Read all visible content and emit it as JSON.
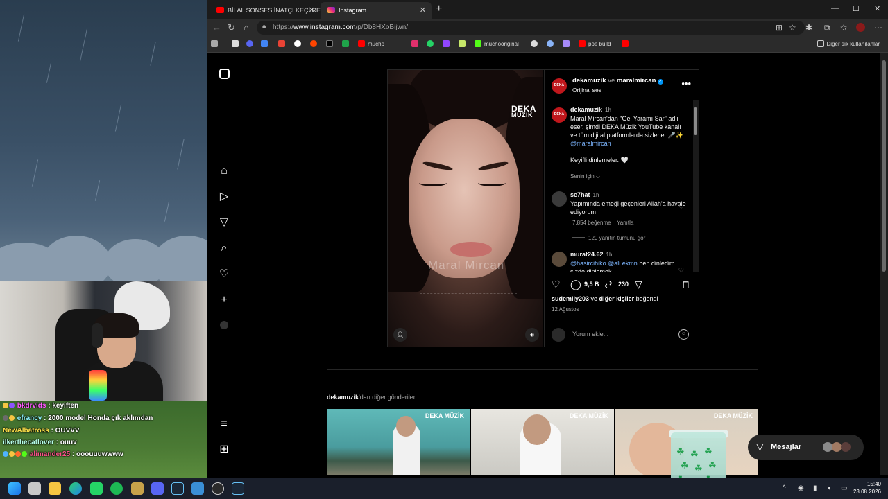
{
  "browser": {
    "tabs": [
      {
        "label": "BİLAL SONSES İNATÇI KEÇİ REMİX",
        "close": "✕"
      },
      {
        "label": "Instagram",
        "close": "✕"
      }
    ],
    "new_tab": "+",
    "url_prefix": "https://",
    "url_domain": "www.instagram.com",
    "url_path": "/p/Db8HXoBijwn/",
    "bookmarks": [
      {
        "label": "mucho",
        "color": "#ff0000"
      },
      {
        "label": "muchooriginal",
        "color": "#53fc18"
      },
      {
        "label": "poe build",
        "color": "#ff0000"
      }
    ],
    "other_bookmarks": "Diğer sık kullanılanlar"
  },
  "chat": [
    {
      "user": "bkdrvids",
      "msg": "keyiften",
      "color": "#ff5cff"
    },
    {
      "user": "efrancy",
      "msg": "2000 model Honda çık aklımdan",
      "color": "#8cf5ff"
    },
    {
      "user": "NewAlbatross",
      "msg": "OUVVV",
      "color": "#ffe24a"
    },
    {
      "user": "ilkerthecatlover",
      "msg": "ouuv",
      "color": "#b7ffea"
    },
    {
      "user": "alimander25",
      "msg": "ooouuuwwww",
      "color": "#ff4f8b"
    }
  ],
  "post": {
    "media": {
      "brand_line1": "DEKA",
      "brand_line2": "MÜZİK",
      "watermark": "Maral Mircan"
    },
    "header": {
      "user1": "dekamuzik",
      "joiner": "ve",
      "user2": "maralmircan",
      "audio": "Orijinal ses",
      "more": "•••"
    },
    "caption": {
      "user": "dekamuzik",
      "time": "1h",
      "text_a": "Maral Mircan'dan \"Gel Yaramı Sar\" adlı eser, şimdi DEKA Müzik YouTube kanalı ve tüm dijital platformlarda sizlerle. 🎤✨",
      "mention": "@maralmircan",
      "text_b": "Keyifli dinlemeler. 🤍",
      "translate": "Senin için ⌵"
    },
    "comments": [
      {
        "user": "se7hat",
        "time": "1h",
        "text": "Yapımında emeği geçenleri Allah'a havale ediyorum",
        "likes": "7.854 beğenme",
        "reply": "Yanıtla",
        "view_replies": "120 yanıtın tümünü gör"
      },
      {
        "user": "murat24.62",
        "time": "1h",
        "mentions": "@hasircihiko @ali.ekmn",
        "text": "ben dinledim sizde dinlemek"
      }
    ],
    "counts": {
      "comments": "9,5 B",
      "reposts": "230"
    },
    "liked_by_user": "sudemily203",
    "liked_by_joiner": "ve",
    "liked_by_others": "diğer kişiler",
    "liked_by_suffix": "beğendi",
    "date": "12 Ağustos",
    "add_comment_placeholder": "Yorum ekle..."
  },
  "more_posts": {
    "user": "dekamuzik",
    "suffix": "'dan diğer gönderiler",
    "thumb_brand": "DEKA MÜZİK"
  },
  "messages": {
    "label": "Mesajlar"
  },
  "taskbar": {
    "time": "15:40",
    "date": "23.08.2026"
  }
}
